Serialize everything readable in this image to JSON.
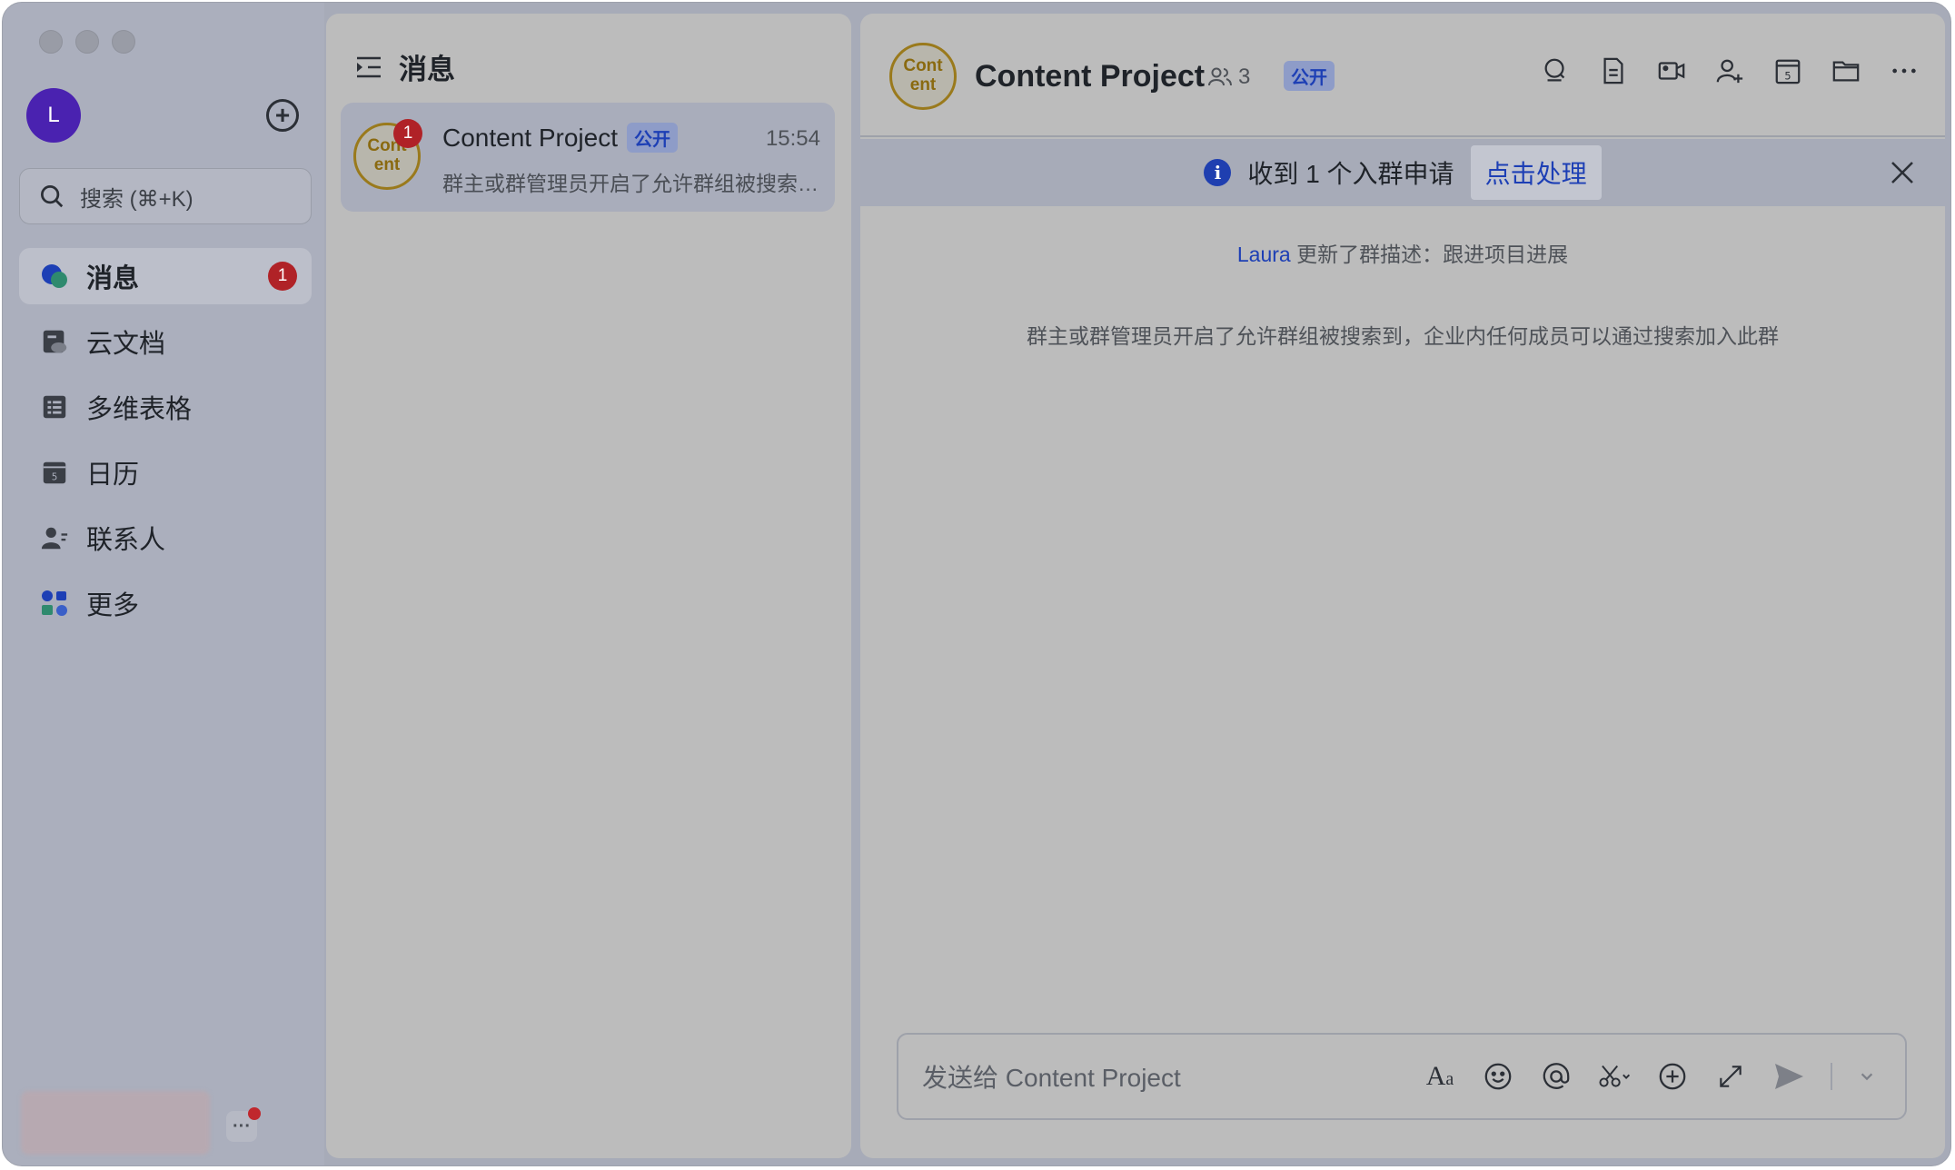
{
  "sidebar": {
    "user_initial": "L",
    "search_placeholder": "搜索 (⌘+K)",
    "items": [
      {
        "label": "消息",
        "badge": "1",
        "active": true,
        "icon": "chat-bubble-icon"
      },
      {
        "label": "云文档",
        "icon": "cloud-doc-icon"
      },
      {
        "label": "多维表格",
        "icon": "table-icon"
      },
      {
        "label": "日历",
        "icon": "calendar-icon"
      },
      {
        "label": "联系人",
        "icon": "contacts-icon"
      },
      {
        "label": "更多",
        "icon": "apps-icon"
      }
    ],
    "more_label": "···"
  },
  "list": {
    "title": "消息",
    "conversations": [
      {
        "avatar_text": "Cont ent",
        "badge": "1",
        "name": "Content Project",
        "tag": "公开",
        "time": "15:54",
        "preview": "群主或群管理员开启了允许群组被搜索到，企业内任何成员可以通过搜索加入此群"
      }
    ]
  },
  "chat": {
    "avatar_text": "Cont ent",
    "title": "Content Project",
    "member_count": "3",
    "tag": "公开",
    "notice": {
      "text": "收到 1 个入群申请",
      "action": "点击处理"
    },
    "messages": [
      {
        "name": "Laura",
        "text": " 更新了群描述：跟进项目进展"
      },
      {
        "text": "群主或群管理员开启了允许群组被搜索到，企业内任何成员可以通过搜索加入此群"
      }
    ],
    "composer_placeholder": "发送给 Content Project"
  },
  "colors": {
    "accent_blue": "#1d3fb5",
    "badge_red": "#b02227",
    "avatar_purple": "#4a22b0",
    "group_avatar_gold": "#9a7a1c"
  }
}
